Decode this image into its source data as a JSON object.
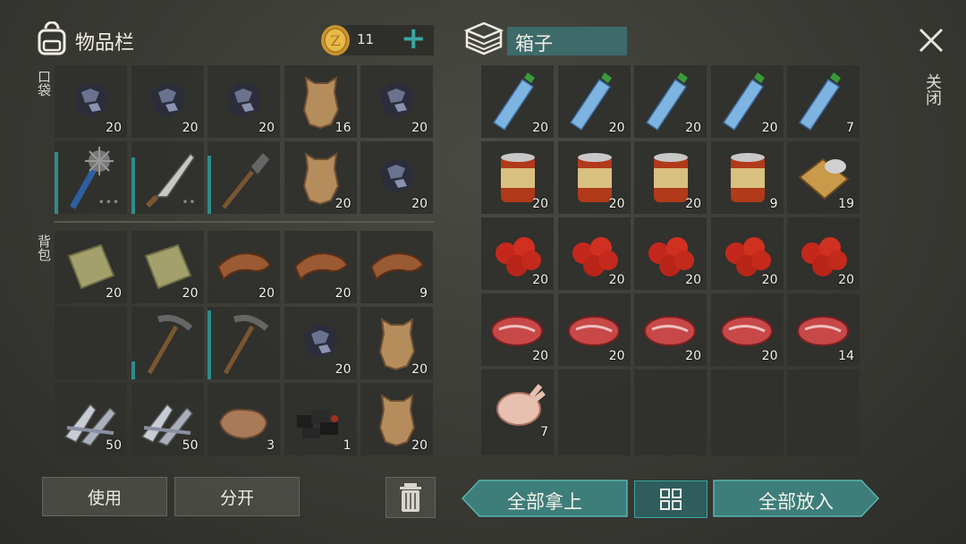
{
  "header": {
    "inventory_title": "物品栏",
    "coins": "11",
    "container_name": "箱子",
    "close_label": "关闭"
  },
  "sections": {
    "pockets": "口袋",
    "backpack": "背包"
  },
  "inventory": {
    "pockets": [
      {
        "item": "coal-ore",
        "qty": "20"
      },
      {
        "item": "coal-ore",
        "qty": "20"
      },
      {
        "item": "coal-ore",
        "qty": "20"
      },
      {
        "item": "animal-hide",
        "qty": "16"
      },
      {
        "item": "coal-ore",
        "qty": "20"
      },
      {
        "item": "spiked-club",
        "qty": "",
        "durability": 0.85
      },
      {
        "item": "machete",
        "qty": "",
        "durability": 0.78
      },
      {
        "item": "shovel",
        "qty": "",
        "durability": 0.8
      },
      {
        "item": "animal-hide",
        "qty": "20"
      },
      {
        "item": "coal-ore",
        "qty": "20"
      }
    ],
    "backpack": [
      {
        "item": "cloth",
        "qty": "20"
      },
      {
        "item": "cloth",
        "qty": "20"
      },
      {
        "item": "leather",
        "qty": "20"
      },
      {
        "item": "leather",
        "qty": "20"
      },
      {
        "item": "leather",
        "qty": "9"
      },
      {
        "item": "empty",
        "qty": ""
      },
      {
        "item": "pickaxe",
        "qty": "",
        "durability": 0.25
      },
      {
        "item": "pickaxe",
        "qty": "",
        "durability": 0.95
      },
      {
        "item": "coal-ore",
        "qty": "20"
      },
      {
        "item": "animal-hide",
        "qty": "20"
      },
      {
        "item": "metal-scraps",
        "qty": "50"
      },
      {
        "item": "metal-scraps",
        "qty": "50"
      },
      {
        "item": "stone",
        "qty": "3"
      },
      {
        "item": "charcoal",
        "qty": "1"
      },
      {
        "item": "animal-hide",
        "qty": "20"
      }
    ]
  },
  "container": [
    {
      "item": "water-bottle",
      "qty": "20"
    },
    {
      "item": "water-bottle",
      "qty": "20"
    },
    {
      "item": "water-bottle",
      "qty": "20"
    },
    {
      "item": "water-bottle",
      "qty": "20"
    },
    {
      "item": "water-bottle",
      "qty": "7"
    },
    {
      "item": "canned-food",
      "qty": "20"
    },
    {
      "item": "canned-food",
      "qty": "20"
    },
    {
      "item": "canned-food",
      "qty": "20"
    },
    {
      "item": "canned-food",
      "qty": "9"
    },
    {
      "item": "open-can",
      "qty": "19"
    },
    {
      "item": "tomatoes",
      "qty": "20"
    },
    {
      "item": "tomatoes",
      "qty": "20"
    },
    {
      "item": "tomatoes",
      "qty": "20"
    },
    {
      "item": "tomatoes",
      "qty": "20"
    },
    {
      "item": "tomatoes",
      "qty": "20"
    },
    {
      "item": "raw-meat",
      "qty": "20"
    },
    {
      "item": "raw-meat",
      "qty": "20"
    },
    {
      "item": "raw-meat",
      "qty": "20"
    },
    {
      "item": "raw-meat",
      "qty": "20"
    },
    {
      "item": "raw-meat",
      "qty": "14"
    },
    {
      "item": "raw-chicken",
      "qty": "7"
    },
    {
      "item": "empty",
      "qty": ""
    },
    {
      "item": "empty",
      "qty": ""
    },
    {
      "item": "empty",
      "qty": ""
    },
    {
      "item": "empty",
      "qty": ""
    }
  ],
  "buttons": {
    "use": "使用",
    "split": "分开",
    "take_all": "全部拿上",
    "put_all": "全部放入"
  },
  "colors": {
    "accent": "#3aa6a0",
    "slot": "#30302c",
    "teal_button": "#3d7d7a"
  }
}
